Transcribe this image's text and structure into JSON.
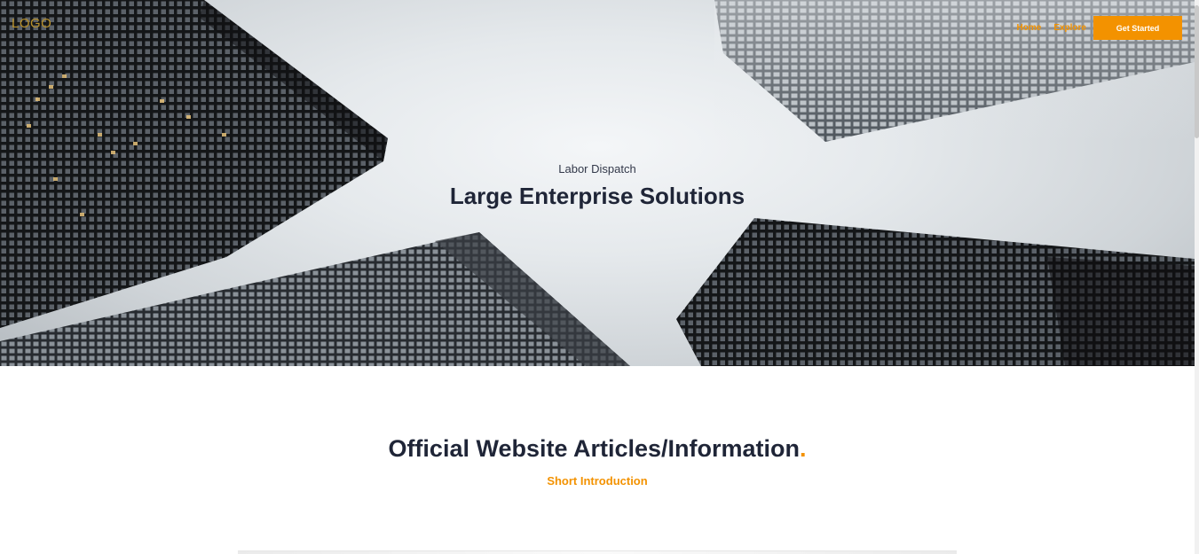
{
  "nav": {
    "logo": "LOGO",
    "links": [
      "Home",
      "Explore"
    ],
    "cta": "Get Started"
  },
  "hero": {
    "eyebrow": "Labor Dispatch",
    "title": "Large Enterprise Solutions"
  },
  "section": {
    "title": "Official Website Articles/Information",
    "title_dot": ".",
    "subtitle": "Short Introduction"
  },
  "colors": {
    "accent": "#f39200",
    "heading": "#1f2537",
    "logo": "#b8902a"
  }
}
